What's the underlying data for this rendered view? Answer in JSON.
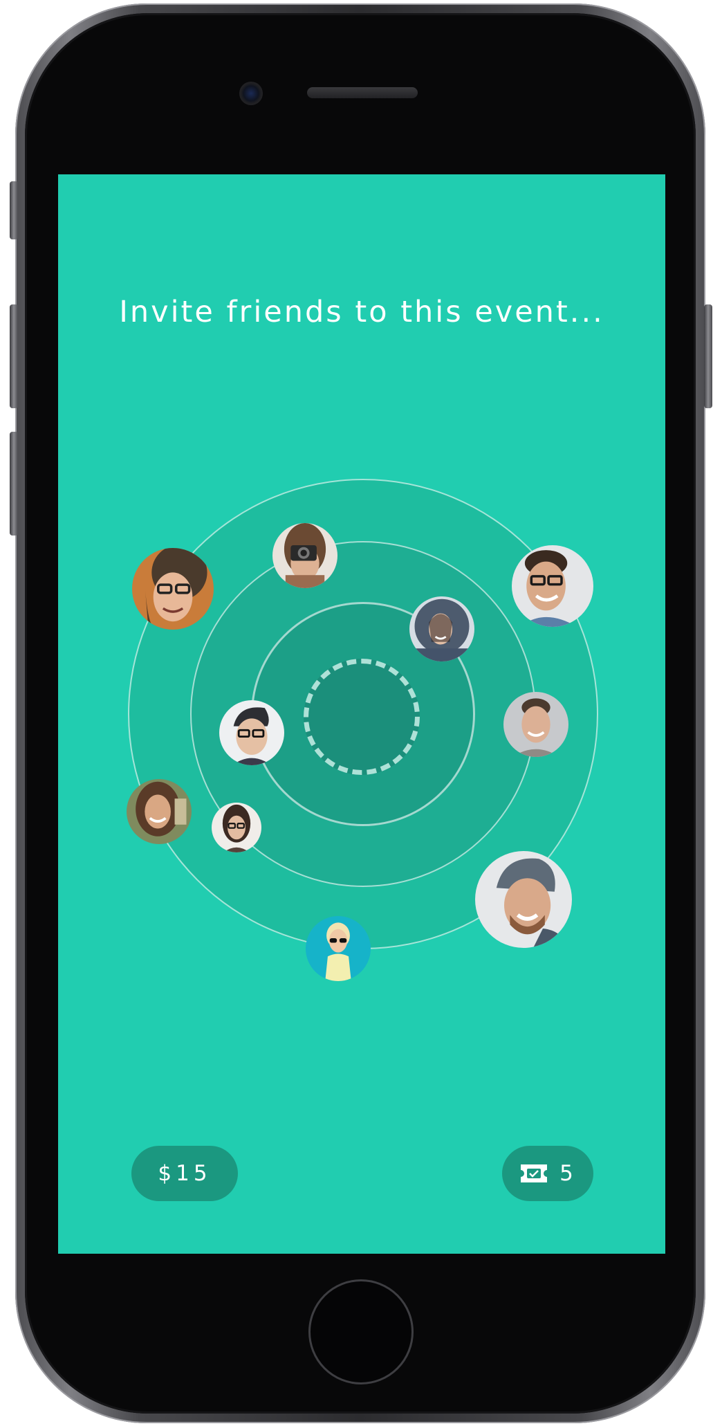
{
  "screen": {
    "title": "Invite friends to this event...",
    "background_color": "#21cdb0"
  },
  "friends": [
    {
      "name": "friend-avatar-1",
      "icon": "person-avatar"
    },
    {
      "name": "friend-avatar-2",
      "icon": "person-avatar"
    },
    {
      "name": "friend-avatar-3",
      "icon": "person-avatar"
    },
    {
      "name": "friend-avatar-4",
      "icon": "person-avatar"
    },
    {
      "name": "friend-avatar-5",
      "icon": "person-avatar"
    },
    {
      "name": "friend-avatar-6",
      "icon": "person-avatar"
    },
    {
      "name": "friend-avatar-7",
      "icon": "person-avatar"
    },
    {
      "name": "friend-avatar-8",
      "icon": "person-avatar"
    },
    {
      "name": "friend-avatar-9",
      "icon": "person-avatar"
    },
    {
      "name": "friend-avatar-10",
      "icon": "person-avatar"
    }
  ],
  "footer": {
    "price_label": "$15",
    "tickets_count": "5",
    "ticket_icon": "ticket-icon"
  }
}
